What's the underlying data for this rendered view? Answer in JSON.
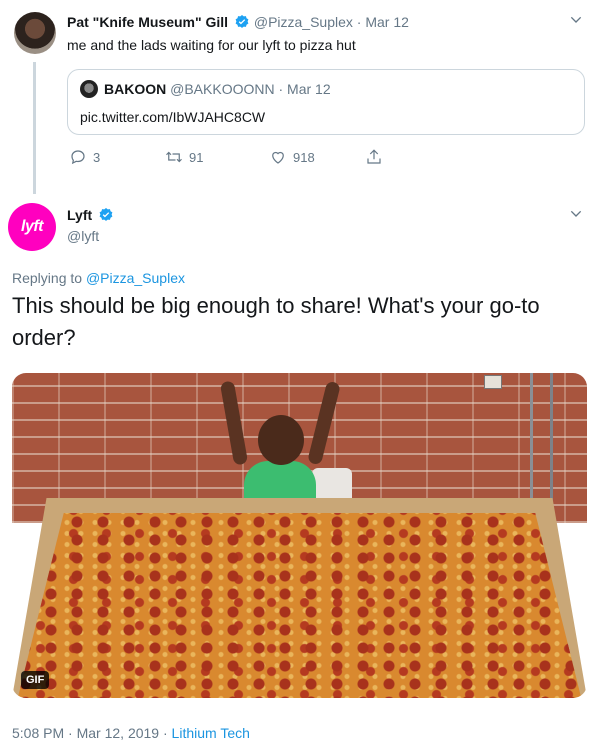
{
  "tweet1": {
    "name": "Pat \"Knife Museum\" Gill",
    "handle": "@Pizza_Suplex",
    "separator": "·",
    "date": "Mar 12",
    "text": "me and the lads waiting for our lyft to pizza hut",
    "quote": {
      "name": "BAKOON",
      "handle": "@BAKKOOONN",
      "separator": "·",
      "date": "Mar 12",
      "text": "pic.twitter.com/IbWJAHC8CW"
    },
    "replies": "3",
    "retweets": "91",
    "likes": "918"
  },
  "tweet2": {
    "avatar_text": "lyft",
    "name": "Lyft",
    "handle": "@lyft",
    "replying_prefix": "Replying to ",
    "replying_handle": "@Pizza_Suplex",
    "body": "This should be big enough to share! What's your go-to order?",
    "gif_label": "GIF",
    "time": "5:08 PM",
    "separator": "·",
    "date": "Mar 12, 2019",
    "source_separator": "·",
    "source": "Lithium Tech"
  },
  "icons": [
    "verified-badge-icon",
    "chevron-down-icon",
    "reply-icon",
    "retweet-icon",
    "like-icon",
    "share-icon"
  ],
  "colors": {
    "link": "#1b95e0",
    "muted": "#657786",
    "lyft_pink": "#ff00bf",
    "border": "#ccd6dd"
  }
}
